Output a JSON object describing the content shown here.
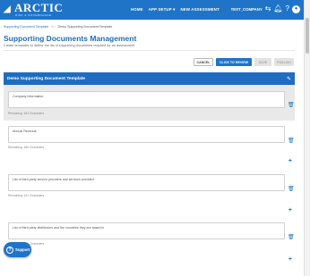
{
  "app": {
    "logo_text": "ARCTIC",
    "logo_subtext": "RISK & GOVERNANCE"
  },
  "nav": {
    "items": [
      "HOME",
      "APP SETUP ▾",
      "NEW ASSESSMENT"
    ]
  },
  "header_right": {
    "company": "TEST_COMPANY",
    "icons": [
      "transfer-icon",
      "bell-icon",
      "help-icon",
      "user-icon"
    ]
  },
  "breadcrumb": {
    "link": "Supporting Document Template",
    "separator": ">>",
    "current": "Demo Supporting Document Template"
  },
  "page": {
    "title": "Supporting Documents Management",
    "subtitle": "Create templates to define the list of supporting documents required for an assessment"
  },
  "actions": {
    "cancel": "CANCEL",
    "review": "CLICK TO REVIEW",
    "save": "SAVE",
    "publish": "PUBLISH"
  },
  "template": {
    "title": "Demo Supporting Document Template",
    "items": [
      {
        "text": "Company Information",
        "remaining": "Remaining: 181 Characters"
      },
      {
        "text": "Annual Revenue",
        "remaining": "Remaining: 186 Characters"
      },
      {
        "text": "List of third party service providers and services provided",
        "remaining": "Remaining: 141 Characters"
      },
      {
        "text": "List of third party distributors and the countries they are based in",
        "remaining": "Remaining: 131 Characters"
      }
    ]
  },
  "support": {
    "label": "Support"
  },
  "colors": {
    "primary": "#1f74c8",
    "panel_header": "#1f6cc0",
    "active_section": "#e9e9e9"
  }
}
